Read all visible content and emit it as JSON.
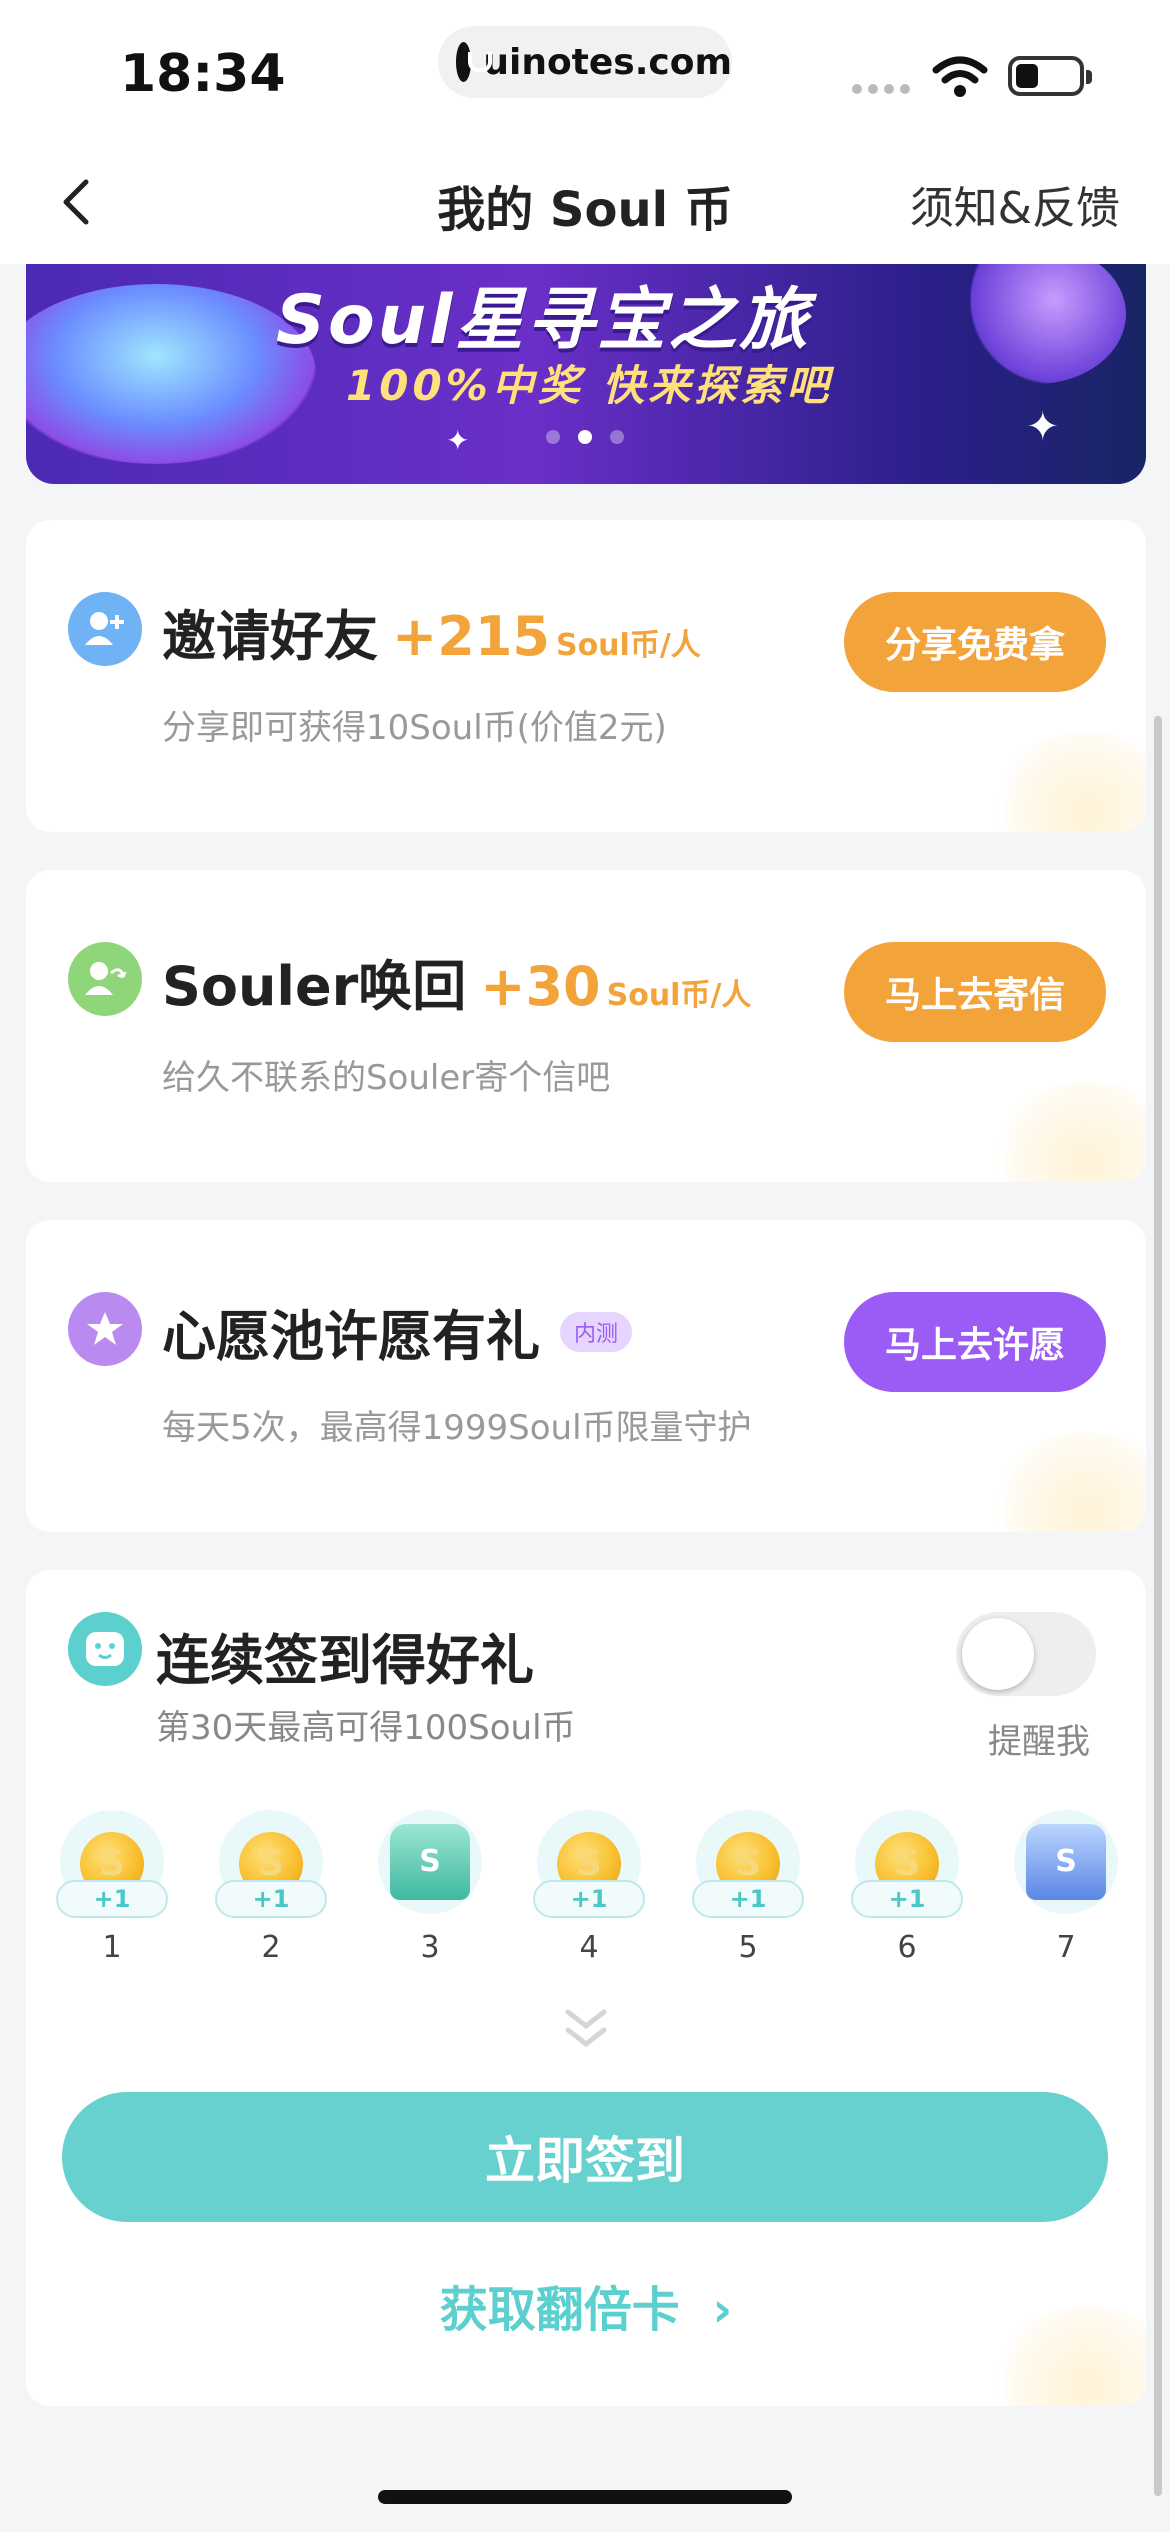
{
  "status_bar": {
    "time": "18:34",
    "url": "uinotes.com"
  },
  "nav": {
    "title": "我的 Soul 币",
    "right_link": "须知&反馈"
  },
  "banner": {
    "title": "Soul星寻宝之旅",
    "subtitle": "100%中奖  快来探索吧",
    "dot_count": 3,
    "active_dot": 1
  },
  "tasks": [
    {
      "title": "邀请好友",
      "reward": "+215",
      "reward_unit": "Soul币/人",
      "desc": "分享即可获得10Soul币(价值2元)",
      "button": "分享免费拿",
      "icon": "add-user-icon",
      "icon_color": "#6fb2f5",
      "button_color": "#f2a33a"
    },
    {
      "title": "Souler唤回",
      "reward": "+30",
      "reward_unit": "Soul币/人",
      "desc": "给久不联系的Souler寄个信吧",
      "button": "马上去寄信",
      "icon": "recall-user-icon",
      "icon_color": "#8fd67a",
      "button_color": "#f2a33a"
    },
    {
      "title": "心愿池许愿有礼",
      "badge": "内测",
      "desc": "每天5次，最高得1999Soul币限量守护",
      "button": "马上去许愿",
      "icon": "star-icon",
      "icon_color": "#b98af0",
      "button_color": "#9b5cf6"
    }
  ],
  "signin": {
    "title": "连续签到得好礼",
    "subtitle": "第30天最高可得100Soul币",
    "remind_label": "提醒我",
    "remind_enabled": false,
    "days": [
      {
        "num": "1",
        "reward": "coin",
        "badge": "+1"
      },
      {
        "num": "2",
        "reward": "coin",
        "badge": "+1"
      },
      {
        "num": "3",
        "reward": "green-chest"
      },
      {
        "num": "4",
        "reward": "coin",
        "badge": "+1"
      },
      {
        "num": "5",
        "reward": "coin",
        "badge": "+1"
      },
      {
        "num": "6",
        "reward": "coin",
        "badge": "+1"
      },
      {
        "num": "7",
        "reward": "blue-chest"
      }
    ],
    "button": "立即签到",
    "double_card_link": "获取翻倍卡"
  }
}
